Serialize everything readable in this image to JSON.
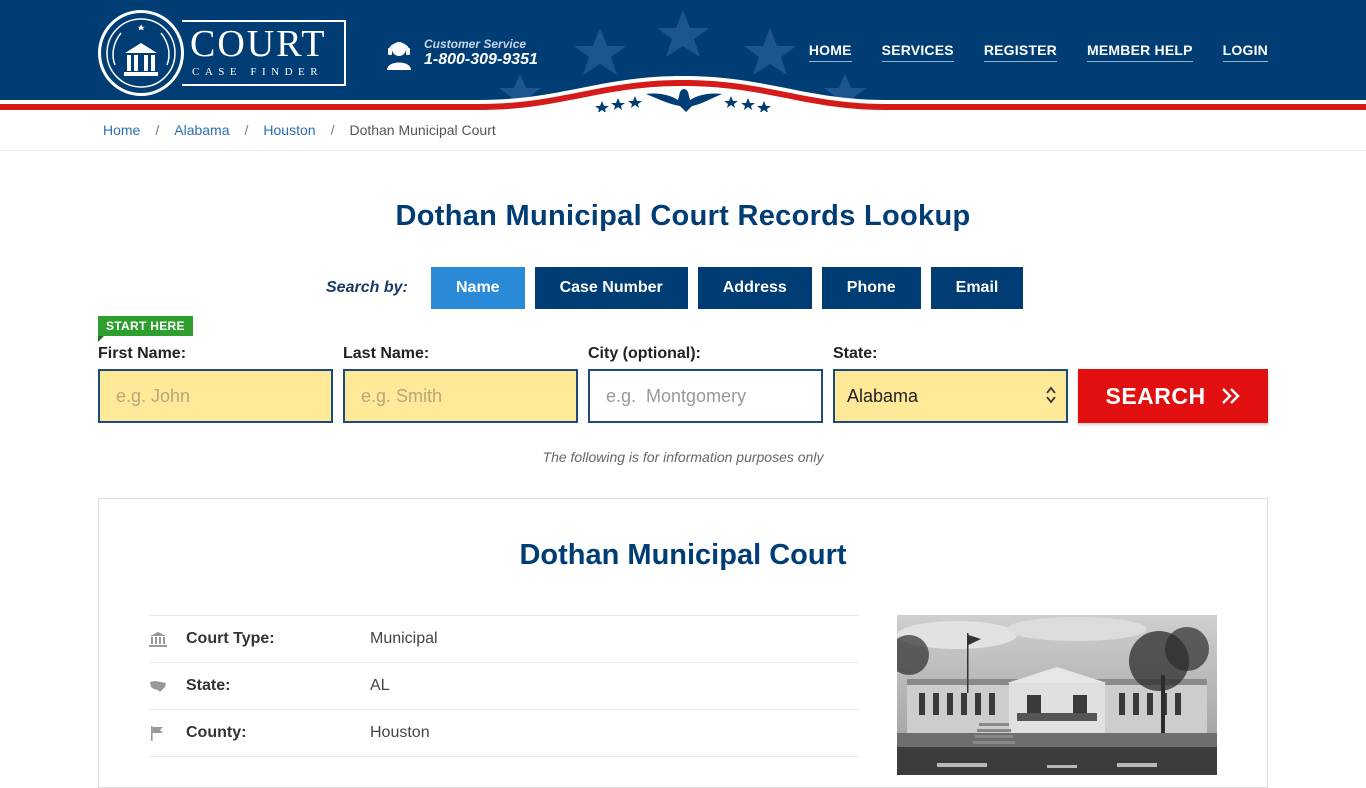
{
  "header": {
    "logo": {
      "title": "COURT",
      "subtitle": "CASE FINDER"
    },
    "customer_service": {
      "label": "Customer Service",
      "phone": "1-800-309-9351"
    },
    "nav": [
      "HOME",
      "SERVICES",
      "REGISTER",
      "MEMBER HELP",
      "LOGIN"
    ],
    "colors": {
      "navy": "#003d74",
      "red": "#d51a1a"
    }
  },
  "breadcrumb": {
    "items": [
      "Home",
      "Alabama",
      "Houston"
    ],
    "current": "Dothan Municipal Court"
  },
  "main": {
    "title": "Dothan Municipal Court Records Lookup",
    "search_by_label": "Search by:",
    "tabs": [
      "Name",
      "Case Number",
      "Address",
      "Phone",
      "Email"
    ],
    "active_tab": "Name",
    "start_here": "START HERE",
    "form": {
      "first_name": {
        "label": "First Name:",
        "placeholder": "e.g. John"
      },
      "last_name": {
        "label": "Last Name:",
        "placeholder": "e.g. Smith"
      },
      "city": {
        "label": "City (optional):",
        "placeholder": "e.g.  Montgomery"
      },
      "state": {
        "label": "State:",
        "value": "Alabama"
      },
      "search_button": "SEARCH"
    },
    "info_note": "The following is for information purposes only"
  },
  "court": {
    "title": "Dothan Municipal Court",
    "details": [
      {
        "icon": "courthouse-icon",
        "label": "Court Type:",
        "value": "Municipal"
      },
      {
        "icon": "us-map-icon",
        "label": "State:",
        "value": "AL"
      },
      {
        "icon": "flag-icon",
        "label": "County:",
        "value": "Houston"
      }
    ]
  }
}
